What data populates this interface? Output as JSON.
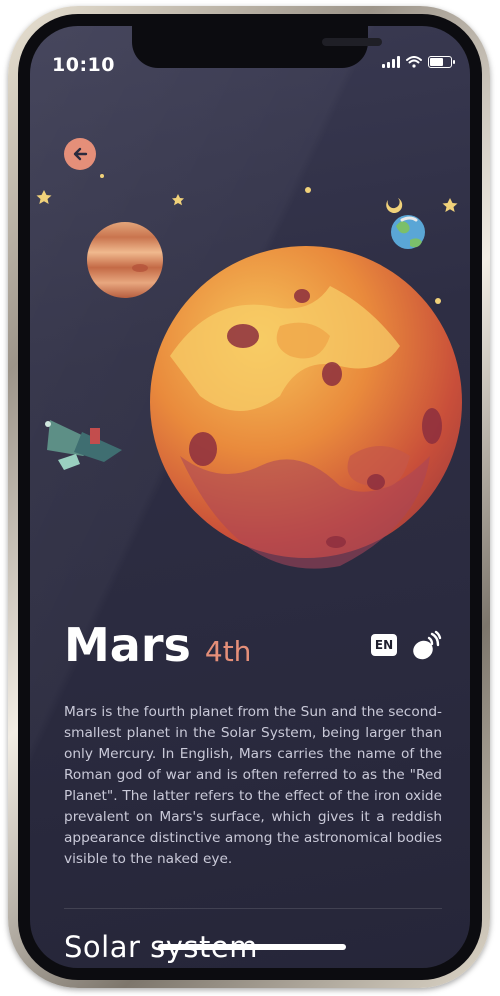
{
  "status_bar": {
    "time": "10:10",
    "icons": [
      "signal-icon",
      "wifi-icon",
      "battery-icon"
    ]
  },
  "navigation": {
    "back_icon": "arrow-left-icon"
  },
  "planet": {
    "name": "Mars",
    "order": "4th",
    "language_label": "EN",
    "listen_icon": "speaker-wave-icon",
    "description": "Mars is the fourth planet from the Sun and the second-smallest planet in the Solar System, being larger than only Mercury. In English, Mars carries the name of the Roman god of war and is often referred to as the \"Red Planet\". The latter refers to the effect of the iron oxide prevalent on Mars's surface, which gives it a reddish appearance distinctive among the astronomical bodies visible to the naked eye."
  },
  "section": {
    "title": "Solar system"
  },
  "colors": {
    "background": "#2e2e44",
    "accent": "#e58f79",
    "text_primary": "#ffffff",
    "text_secondary": "#c9c9d8"
  }
}
